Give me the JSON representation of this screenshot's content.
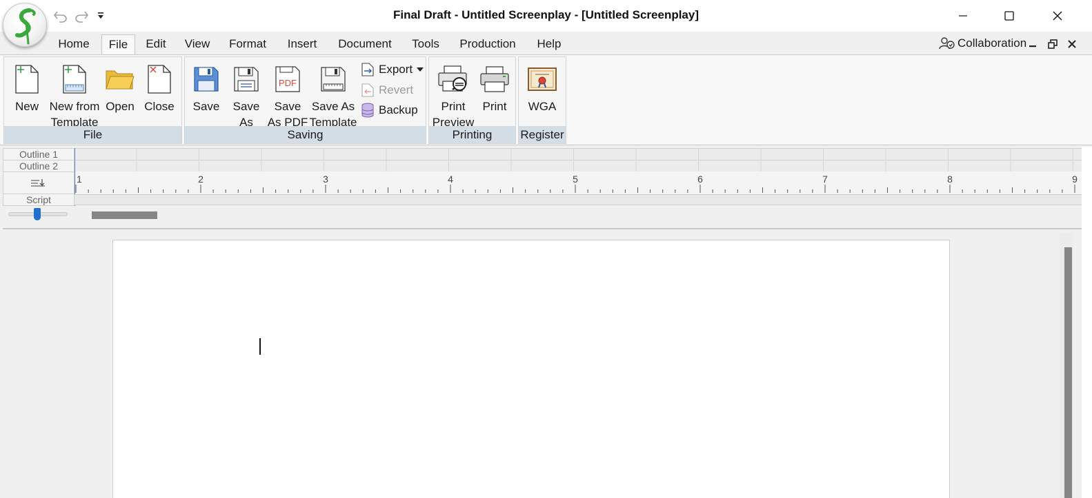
{
  "window": {
    "title": "Final Draft - Untitled Screenplay - [Untitled Screenplay]"
  },
  "quick_access": {
    "undo_icon": "undo-icon",
    "redo_icon": "redo-icon",
    "customize_icon": "customize-qat-icon"
  },
  "tabs": [
    {
      "label": "Home"
    },
    {
      "label": "File"
    },
    {
      "label": "Edit"
    },
    {
      "label": "View"
    },
    {
      "label": "Format"
    },
    {
      "label": "Insert"
    },
    {
      "label": "Document"
    },
    {
      "label": "Tools"
    },
    {
      "label": "Production"
    },
    {
      "label": "Help"
    }
  ],
  "active_tab": "File",
  "collaboration": {
    "label": "Collaboration"
  },
  "ribbon": {
    "groups": {
      "file": {
        "label": "File",
        "new": "New",
        "new_from_template": "New from\nTemplate",
        "open": "Open",
        "close": "Close"
      },
      "saving": {
        "label": "Saving",
        "save": "Save",
        "save_as": "Save\nAs",
        "save_as_pdf": "Save\nAs PDF",
        "save_as_template": "Save As\nTemplate",
        "export": "Export",
        "revert": "Revert",
        "backup": "Backup",
        "pdf_icon_text": "PDF"
      },
      "printing": {
        "label": "Printing",
        "print_preview": "Print\nPreview",
        "print": "Print"
      },
      "register": {
        "label": "Register",
        "wga": "WGA"
      }
    }
  },
  "outline": {
    "outline1": "Outline 1",
    "outline2": "Outline 2",
    "script": "Script"
  },
  "ruler": {
    "labels": [
      "1",
      "2",
      "3",
      "4",
      "5",
      "6",
      "7",
      "8",
      "9"
    ]
  },
  "colors": {
    "accent": "#1e6fd0",
    "group_label_bg": "#d3dde6",
    "logo_green": "#3aa83a"
  }
}
